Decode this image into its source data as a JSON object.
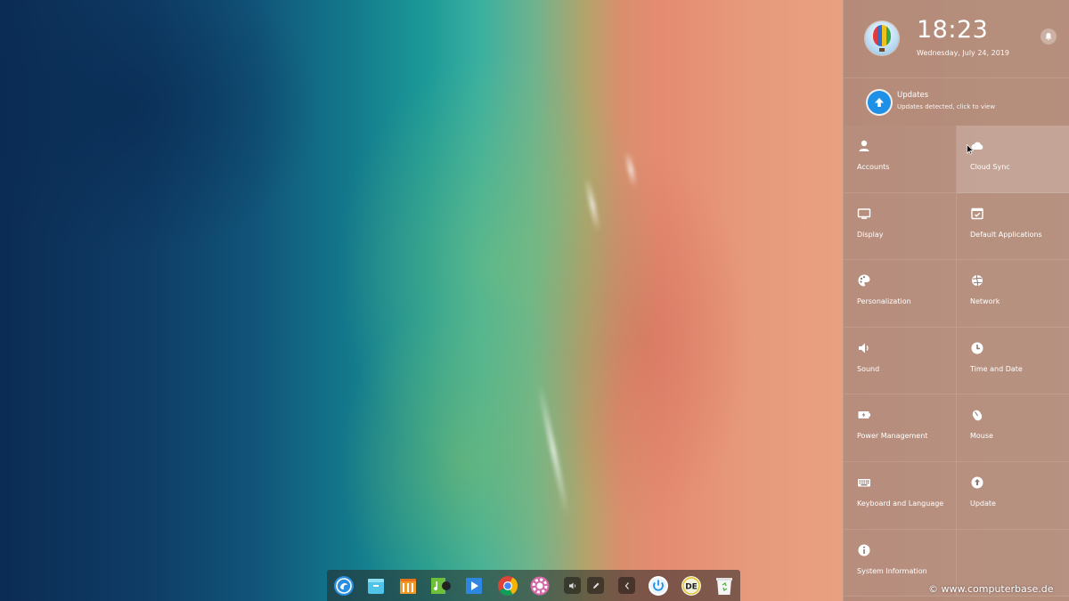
{
  "control_center": {
    "time": "18:23",
    "date": "Wednesday, July 24, 2019",
    "notification": {
      "title": "Updates",
      "subtitle": "Updates detected, click to view"
    },
    "tiles": [
      {
        "label": "Accounts",
        "icon": "user-icon"
      },
      {
        "label": "Cloud Sync",
        "icon": "cloud-icon"
      },
      {
        "label": "Display",
        "icon": "monitor-icon"
      },
      {
        "label": "Default Applications",
        "icon": "default-apps-icon"
      },
      {
        "label": "Personalization",
        "icon": "palette-icon"
      },
      {
        "label": "Network",
        "icon": "globe-icon"
      },
      {
        "label": "Sound",
        "icon": "speaker-icon"
      },
      {
        "label": "Time and Date",
        "icon": "clock-icon"
      },
      {
        "label": "Power Management",
        "icon": "battery-icon"
      },
      {
        "label": "Mouse",
        "icon": "mouse-icon"
      },
      {
        "label": "Keyboard and Language",
        "icon": "keyboard-icon"
      },
      {
        "label": "Update",
        "icon": "update-icon"
      },
      {
        "label": "System Information",
        "icon": "info-icon"
      }
    ]
  },
  "dock": {
    "apps": [
      "launcher-icon",
      "file-manager-icon",
      "app-store-icon",
      "music-player-icon",
      "movie-player-icon",
      "chrome-icon",
      "settings-icon"
    ],
    "tray": [
      "volume-icon",
      "pen-icon",
      "chevron-left-icon",
      "power-icon",
      "keyboard-layout-icon",
      "trash-icon"
    ]
  },
  "watermark": "© www.computerbase.de"
}
